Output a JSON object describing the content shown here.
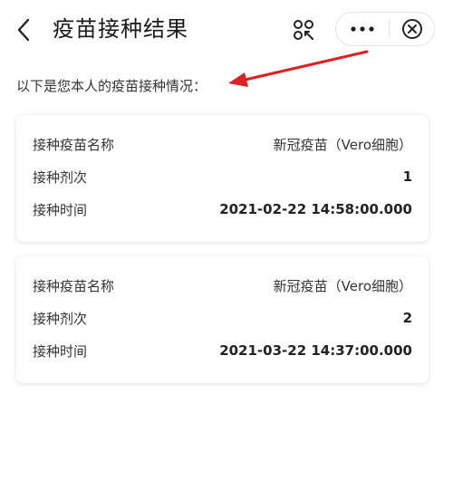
{
  "navbar": {
    "title": "疫苗接种结果",
    "back_icon": "chevron-left-icon",
    "scan_icon": "scan-qr-icon",
    "more_icon": "more-dots-icon",
    "close_icon": "close-circle-icon"
  },
  "intro": "以下是您本人的疫苗接种情况：",
  "colors": {
    "annotation_arrow": "#e02020",
    "card_shadow": "#d9d9d9"
  },
  "records": [
    {
      "name_label": "接种疫苗名称",
      "name_value": "新冠疫苗（Vero细胞）",
      "dose_label": "接种剂次",
      "dose_value": "1",
      "time_label": "接种时间",
      "time_value": "2021-02-22 14:58:00.000"
    },
    {
      "name_label": "接种疫苗名称",
      "name_value": "新冠疫苗（Vero细胞）",
      "dose_label": "接种剂次",
      "dose_value": "2",
      "time_label": "接种时间",
      "time_value": "2021-03-22 14:37:00.000"
    }
  ]
}
